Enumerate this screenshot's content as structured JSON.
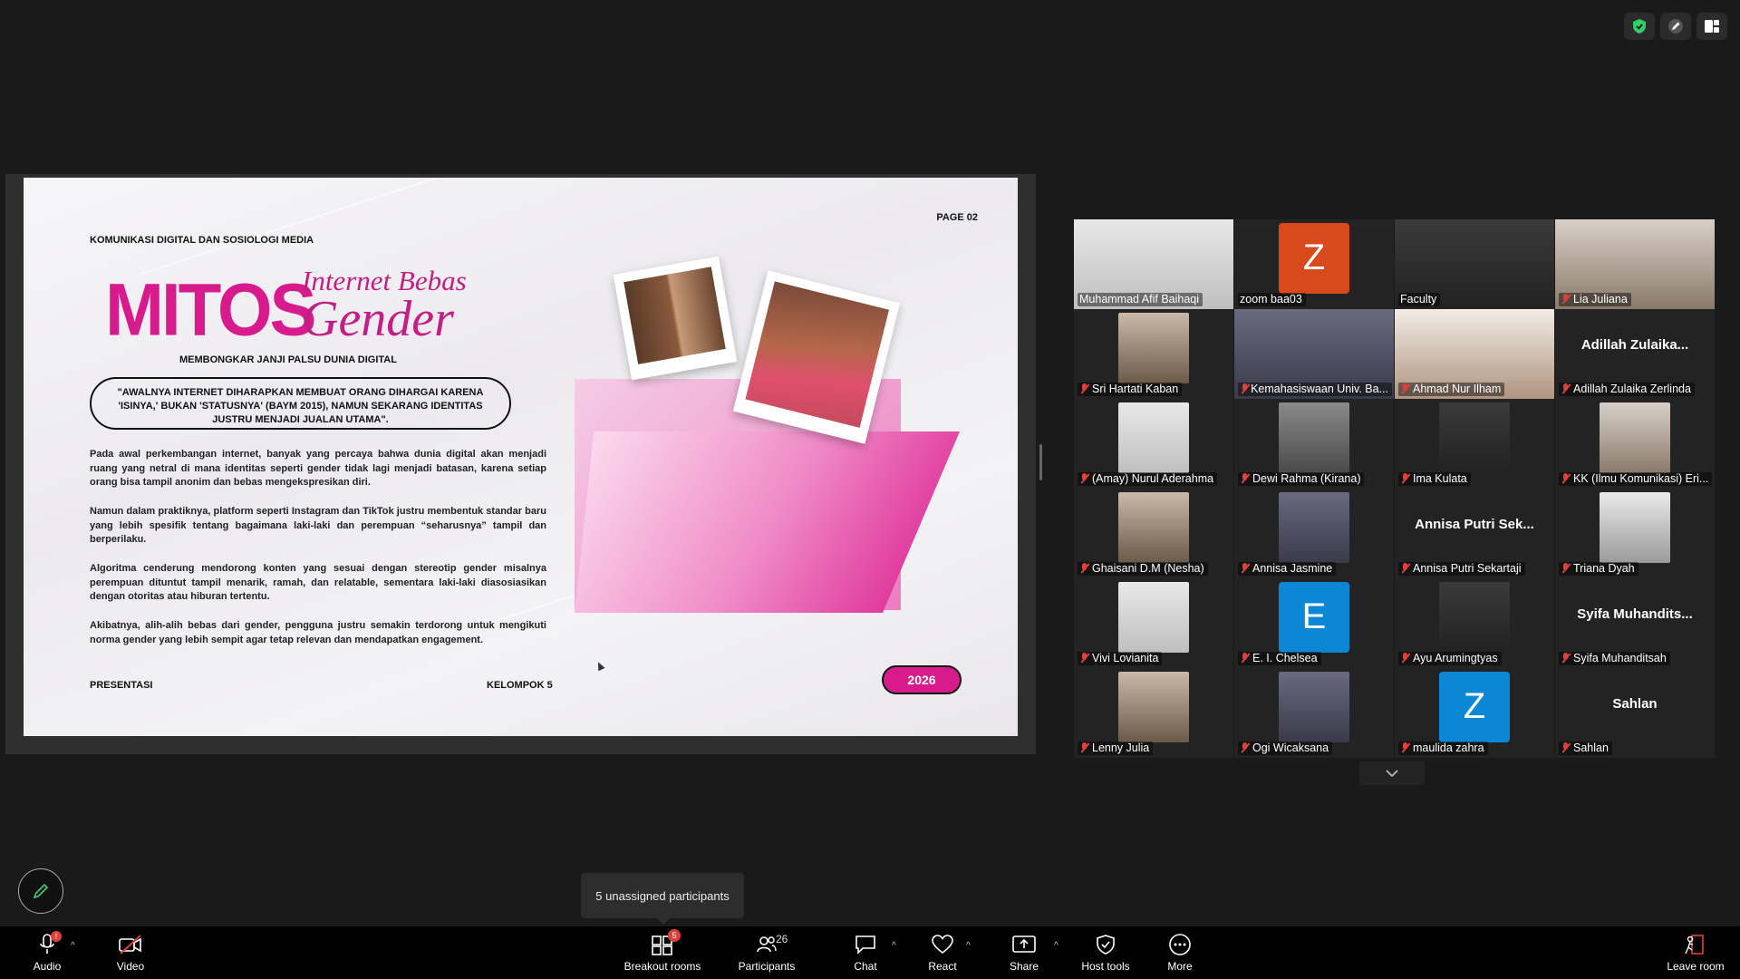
{
  "slide": {
    "page": "PAGE 02",
    "course": "KOMUNIKASI DIGITAL DAN SOSIOLOGI MEDIA",
    "title": "MITOS",
    "subtitle_line1": "Internet Bebas",
    "subtitle_line2": "Gender",
    "tagline": "MEMBONGKAR JANJI PALSU DUNIA DIGITAL",
    "quote": "\"AWALNYA INTERNET DIHARAPKAN MEMBUAT ORANG DIHARGAI KARENA 'ISINYA,' BUKAN 'STATUSNYA' (BAYM 2015), NAMUN SEKARANG IDENTITAS JUSTRU MENJADI JUALAN UTAMA\".",
    "paragraphs": [
      "Pada awal perkembangan internet, banyak yang percaya bahwa dunia digital akan menjadi ruang yang netral di mana identitas seperti gender tidak lagi menjadi batasan, karena setiap orang bisa tampil anonim dan bebas mengekspresikan diri.",
      "Namun dalam praktiknya, platform seperti Instagram dan TikTok justru membentuk standar baru yang lebih spesifik tentang bagaimana laki-laki dan perempuan “seharusnya” tampil dan berperilaku.",
      "Algoritma cenderung mendorong konten yang sesuai dengan stereotip gender misalnya perempuan dituntut tampil menarik, ramah, dan relatable, sementara laki-laki diasosiasikan dengan otoritas atau hiburan tertentu.",
      "Akibatnya, alih-alih bebas dari gender, pengguna justru semakin terdorong untuk mengikuti norma gender yang lebih sempit agar tetap relevan dan mendapatkan engagement."
    ],
    "footer_left": "PRESENTASI",
    "footer_mid": "KELOMPOK 5",
    "year": "2026",
    "accent_color": "#d81b8c"
  },
  "participants": [
    {
      "name": "Muhammad Afif Baihaqi",
      "kind": "video",
      "muted": false,
      "active": true
    },
    {
      "name": "zoom baa03",
      "kind": "avatar",
      "letter": "Z",
      "color": "#d84a1b",
      "muted": false
    },
    {
      "name": "Faculty",
      "kind": "video",
      "muted": false
    },
    {
      "name": "Lia Juliana",
      "kind": "video",
      "muted": true
    },
    {
      "name": "Sri Hartati Kaban",
      "kind": "video",
      "muted": true
    },
    {
      "name": "Kemahasiswaan Univ. Ba...",
      "kind": "video",
      "muted": true
    },
    {
      "name": "Ahmad Nur Ilham",
      "kind": "video",
      "muted": true
    },
    {
      "name": "Adillah Zulaika Zerlinda",
      "kind": "name",
      "big": "Adillah  Zulaika...",
      "muted": true
    },
    {
      "name": "(Amay) Nurul Aderahma",
      "kind": "video",
      "muted": true
    },
    {
      "name": "Dewi Rahma (Kirana)",
      "kind": "video",
      "muted": true
    },
    {
      "name": "Ima Kulata",
      "kind": "video",
      "muted": true
    },
    {
      "name": "KK (Ilmu Komunikasi) Eri...",
      "kind": "video",
      "muted": true
    },
    {
      "name": "Ghaisani D.M (Nesha)",
      "kind": "video",
      "muted": true
    },
    {
      "name": "Annisa Jasmine",
      "kind": "video",
      "muted": true
    },
    {
      "name": "Annisa Putri Sekartaji",
      "kind": "name",
      "big": "Annisa Putri Sek...",
      "muted": true
    },
    {
      "name": "Triana Dyah",
      "kind": "video",
      "muted": true
    },
    {
      "name": "Vivi Lovianita",
      "kind": "video",
      "muted": true
    },
    {
      "name": "E. I. Chelsea",
      "kind": "avatar",
      "letter": "E",
      "color": "#0b87d6",
      "muted": true
    },
    {
      "name": "Ayu Arumingtyas",
      "kind": "video",
      "muted": true
    },
    {
      "name": "Syifa Muhanditsah",
      "kind": "name",
      "big": "Syifa  Muhandits...",
      "muted": true
    },
    {
      "name": "Lenny Julia",
      "kind": "video",
      "muted": true
    },
    {
      "name": "Ogi Wicaksana",
      "kind": "video",
      "muted": true
    },
    {
      "name": "maulida zahra",
      "kind": "avatar",
      "letter": "Z",
      "color": "#0b87d6",
      "muted": true
    },
    {
      "name": "Sahlan",
      "kind": "name",
      "big": "Sahlan",
      "muted": true
    }
  ],
  "tooltip": "5 unassigned participants",
  "toolbar": {
    "audio": "Audio",
    "video": "Video",
    "breakout": "Breakout rooms",
    "breakout_badge": "5",
    "participants": "Participants",
    "participants_count": "26",
    "chat": "Chat",
    "react": "React",
    "share": "Share",
    "host_tools": "Host tools",
    "more": "More",
    "leave": "Leave room"
  }
}
